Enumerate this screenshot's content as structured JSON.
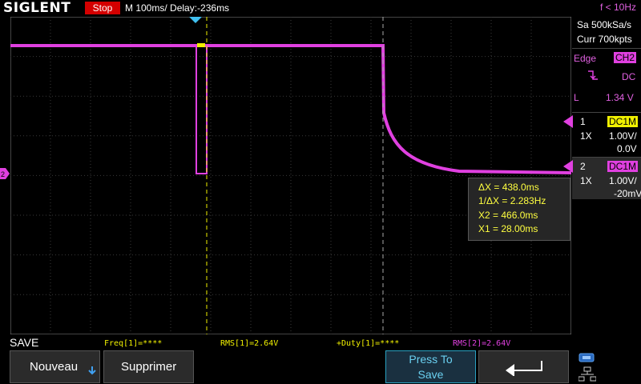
{
  "header": {
    "brand": "SIGLENT",
    "run_state": "Stop",
    "timebase": "M 100ms/",
    "delay": "Delay:-236ms",
    "trigger_freq": "f < 10Hz"
  },
  "acquisition": {
    "sample_rate": "Sa 500kSa/s",
    "memory": "Curr 700kpts"
  },
  "trigger": {
    "type": "Edge",
    "source": "CH2",
    "coupling": "DC",
    "level_prefix": "L",
    "level": "1.34 V"
  },
  "channels": [
    {
      "number": "1",
      "coupling": "DC1M",
      "probe": "1X",
      "scale": "1.00V/",
      "offset": "0.0V",
      "color": "#f0f000"
    },
    {
      "number": "2",
      "coupling": "DC1M",
      "probe": "1X",
      "scale": "1.00V/",
      "offset": "-20mV",
      "color": "#e040e0"
    }
  ],
  "cursors": {
    "delta_x": "ΔX = 438.0ms",
    "inv_delta_x": "1/ΔX = 2.283Hz",
    "x2": "X2 = 466.0ms",
    "x1": "X1 = 28.00ms"
  },
  "menu": {
    "title": "SAVE",
    "buttons": {
      "nouveau": "Nouveau",
      "supprimer": "Supprimer",
      "press_to_save_line1": "Press To",
      "press_to_save_line2": "Save"
    }
  },
  "measurements": [
    {
      "text": "Freq[1]=****",
      "color": "#f0f000"
    },
    {
      "text": "RMS[1]=2.64V",
      "color": "#f0f000"
    },
    {
      "text": "+Duty[1]=****",
      "color": "#f0f000"
    },
    {
      "text": "RMS[2]=2.64V",
      "color": "#e040e0"
    }
  ],
  "colors": {
    "ch1": "#f0f000",
    "ch2": "#e040e0",
    "stop_bg": "#d40000",
    "cursor": "#f0f000",
    "trigger_marker": "#40c0f0"
  },
  "icons": [
    "down-arrow-icon",
    "back-arrow-icon",
    "usb-icon",
    "network-icon",
    "trigger-edge-icon"
  ]
}
